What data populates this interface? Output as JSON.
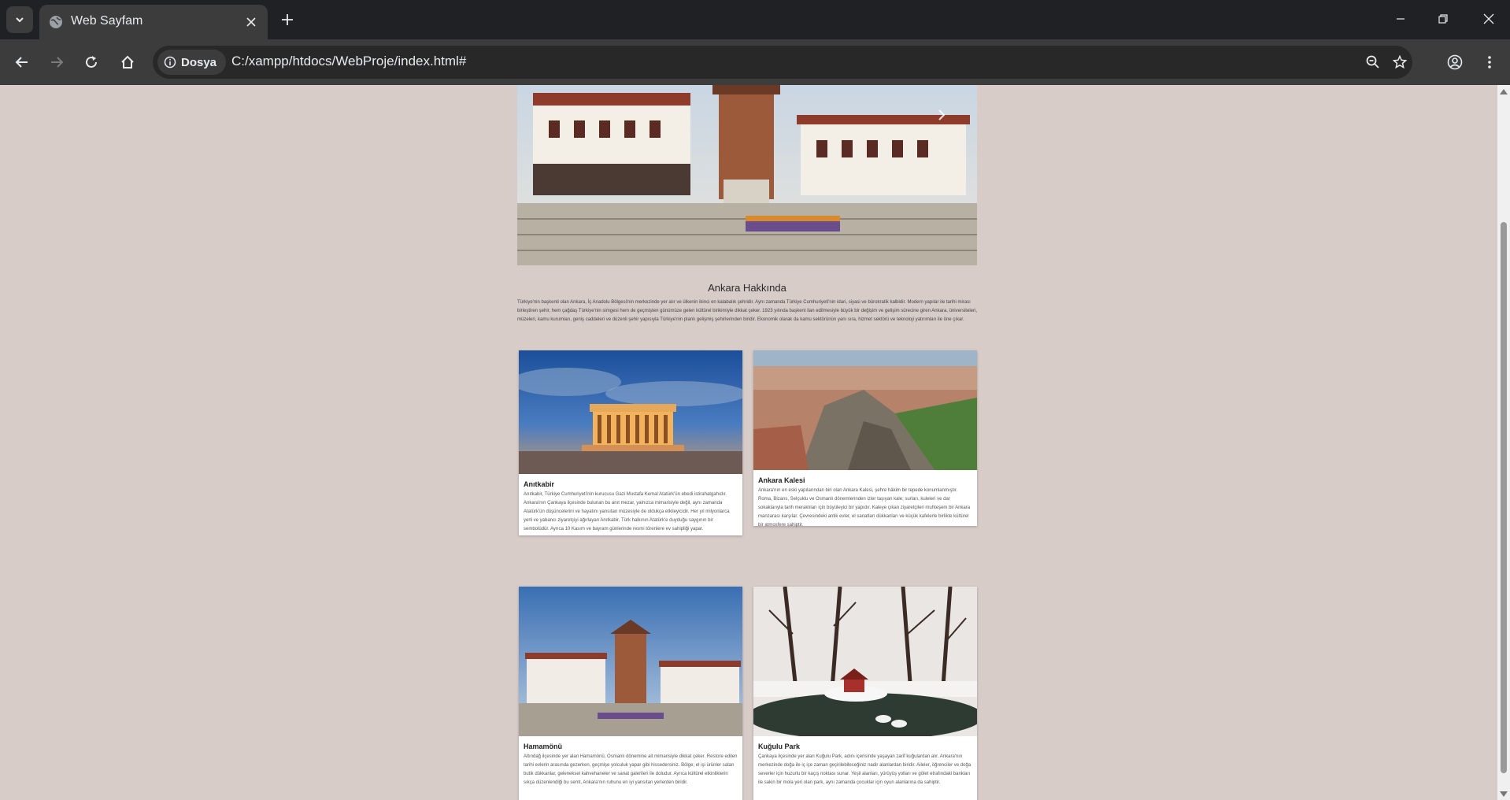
{
  "browser": {
    "tab_title": "Web Sayfam",
    "site_chip_label": "Dosya",
    "url": "C:/xampp/htdocs/WebProje/index.html#"
  },
  "about": {
    "title": "Ankara Hakkında",
    "text": "Türkiye'nin başkenti olan Ankara, İç Anadolu Bölgesi'nin merkezinde yer alır ve ülkenin ikinci en kalabalık şehridir. Aynı zamanda Türkiye Cumhuriyeti'nin idari, siyasi ve bürokratik kalbidir. Modern yapılar ile tarihi mirası birleştiren şehir, hem çağdaş Türkiye'nin simgesi hem de geçmişten günümüze gelen kültürel birikimiyle dikkat çeker. 1923 yılında başkent ilan edilmesiyle büyük bir değişim ve gelişim sürecine giren Ankara, üniversiteleri, müzeleri, kamu kurumları, geniş caddeleri ve düzenli şehir yapısıyla Türkiye'nin planlı gelişmiş şehirlerinden biridir. Ekonomik olarak da kamu sektörünün yanı sıra, hizmet sektörü ve teknoloji yatırımları ile öne çıkar."
  },
  "cards": [
    {
      "title": "Anıtkabir",
      "text": "Anıtkabir, Türkiye Cumhuriyeti'nin kurucusu Gazi Mustafa Kemal Atatürk'ün ebedi istirahatgahıdır. Ankara'nın Çankaya ilçesinde bulunan bu anıt mezar, yalnızca mimarisiyle değil, aynı zamanda Atatürk'ün düşüncelerini ve hayatını yansıtan müzesiyle de oldukça etkileyicidir. Her yıl milyonlarca yerli ve yabancı ziyaretçiyi ağırlayan Anıtkabir, Türk halkının Atatürk'e duyduğu saygının bir sembolüdür. Ayrıca 10 Kasım ve bayram günlerinde resmi törenlere ev sahipliği yapar."
    },
    {
      "title": "Ankara Kalesi",
      "text": "Ankara'nın en eski yapılarından biri olan Ankara Kalesi, şehre hâkim bir tepede konumlanmıştır. Roma, Bizans, Selçuklu ve Osmanlı dönemlerinden izler taşıyan kale; surları, kuleleri ve dar sokaklarıyla tarih meraklıları için büyüleyici bir yapıdır. Kaleye çıkan ziyaretçileri muhteşem bir Ankara manzarası karşılar. Çevresindeki antik evler, el sanatları dükkanları ve küçük kafelerle birlikte kültürel bir atmosfere sahiptir."
    },
    {
      "title": "Hamamönü",
      "text": "Altındağ ilçesinde yer alan Hamamönü, Osmanlı dönemine ait mimarisiyle dikkat çeker. Restore edilen tarihi evlerin arasında gezerken, geçmişe yolculuk yapar gibi hissedersiniz. Bölge; el işi ürünler satan butik dükkanlar, geleneksel kahvehaneler ve sanat galerileri ile doludur. Ayrıca kültürel etkinliklerin sıkça düzenlendiği bu semt, Ankara'nın ruhunu en iyi yansıtan yerlerden biridir."
    },
    {
      "title": "Kuğulu Park",
      "text": "Çankaya ilçesinde yer alan Kuğulu Park, adını içerisinde yaşayan zarif kuğulardan alır. Ankara'nın merkezinde doğa ile iç içe zaman geçirilebileceğiniz nadir alanlardan biridir. Aileler, öğrenciler ve doğa severler için huzurlu bir kaçış noktası sunar. Yeşil alanları, yürüyüş yolları ve gölet etrafındaki bankları ile sakin bir mola yeri olan park, aynı zamanda çocuklar için oyun alanlarına da sahiptir."
    }
  ]
}
